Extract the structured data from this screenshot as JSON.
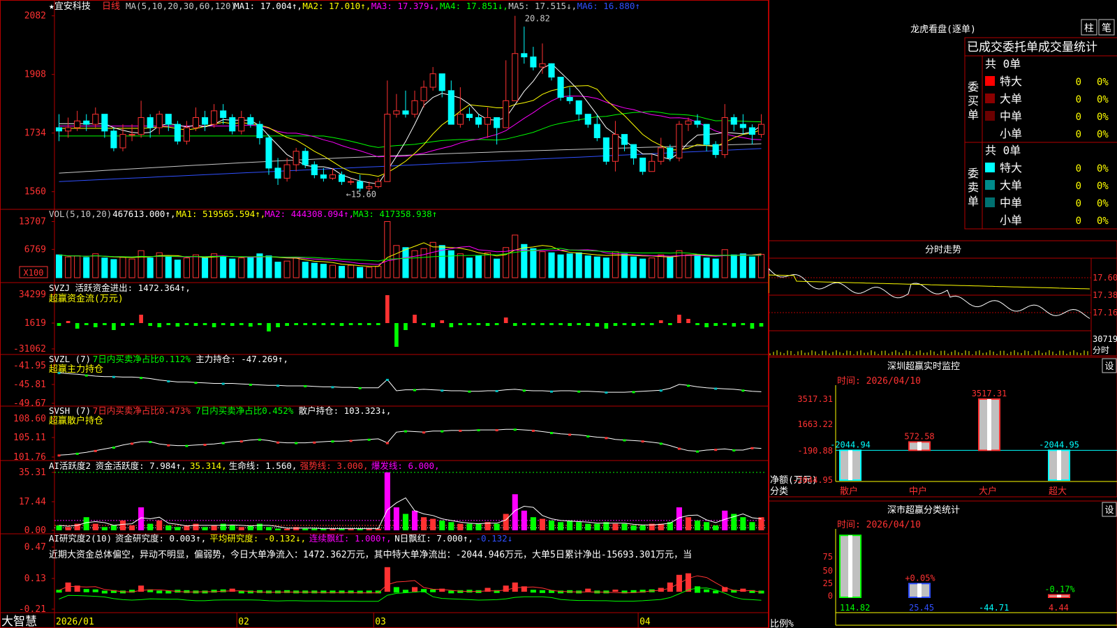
{
  "app": {
    "brand": "大智慧"
  },
  "stock": {
    "star": "★",
    "name": "宜安科技",
    "period": "日线"
  },
  "colors": {
    "up": "#ff3232",
    "down": "#00ffff",
    "ma1": "#ffffff",
    "ma2": "#ffff00",
    "ma3": "#ff00ff",
    "ma4": "#00ff00",
    "ma5": "#c8c8c8",
    "ma6": "#3050ff",
    "green": "#00ff00",
    "magenta": "#ff00ff",
    "yellow": "#ffff00"
  },
  "price_panel": {
    "header": [
      {
        "t": "MA(5,10,20,30,60,120)",
        "c": "#c8c8c8"
      },
      {
        "t": "MA1: 17.004↑,",
        "c": "#ffffff"
      },
      {
        "t": "MA2: 17.010↑,",
        "c": "#ffff00"
      },
      {
        "t": "MA3: 17.379↓,",
        "c": "#ff00ff"
      },
      {
        "t": "MA4: 17.851↓,",
        "c": "#00ff00"
      },
      {
        "t": "MA5: 17.515↓,",
        "c": "#c8c8c8"
      },
      {
        "t": "MA6: 16.880↑",
        "c": "#3050ff"
      }
    ],
    "yticks": [
      "2082",
      "1908",
      "1734",
      "1560"
    ],
    "high_label": "20.82",
    "low_label": "←15.60"
  },
  "vol_panel": {
    "header": [
      {
        "t": "VOL(5,10,20)",
        "c": "#c8c8c8"
      },
      {
        "t": "467613.000↑,",
        "c": "#ffffff"
      },
      {
        "t": "MA1: 519565.594↑,",
        "c": "#ffff00"
      },
      {
        "t": "MA2: 444308.094↑,",
        "c": "#ff00ff"
      },
      {
        "t": "MA3: 417358.938↑",
        "c": "#00ff00"
      }
    ],
    "yticks": [
      "13707",
      "6769"
    ],
    "unit": "X100"
  },
  "svzj_panel": {
    "header": [
      {
        "t": "SVZJ  活跃资金进出: 1472.364↑,",
        "c": "#ffffff"
      }
    ],
    "sub": "超赢资金流(万元)",
    "yticks": [
      "34299",
      "1619",
      "-31062"
    ]
  },
  "svzl_panel": {
    "header": [
      {
        "t": "SVZL (7)",
        "c": "#ffffff"
      },
      {
        "t": "7日内买卖净占比0.112%",
        "c": "#00ff00"
      },
      {
        "t": "主力持仓: -47.269↑,",
        "c": "#ffffff"
      }
    ],
    "sub": "超赢主力持仓",
    "yticks": [
      "-41.95",
      "-45.81",
      "-49.67"
    ]
  },
  "svsh_panel": {
    "header": [
      {
        "t": "SVSH (7)",
        "c": "#ffffff"
      },
      {
        "t": "7日内买卖净占比0.473%",
        "c": "#ff3232"
      },
      {
        "t": "7日内买卖净占比0.452%",
        "c": "#00ff00"
      },
      {
        "t": "散户持仓: 103.323↓,",
        "c": "#ffffff"
      }
    ],
    "sub": "超赢散户持仓",
    "yticks": [
      "108.60",
      "105.11",
      "101.76"
    ]
  },
  "ai_panel": {
    "header": [
      {
        "t": "AI活跃度2",
        "c": "#ffffff"
      },
      {
        "t": "资金活跃度: 7.984↑,",
        "c": "#ffffff"
      },
      {
        "t": "35.314,",
        "c": "#ffff00"
      },
      {
        "t": "生命线: 1.560,",
        "c": "#ffffff"
      },
      {
        "t": "强势线: 3.000,",
        "c": "#ff3232"
      },
      {
        "t": "爆发线: 6.000,",
        "c": "#ff00ff"
      }
    ],
    "yticks": [
      "35.31",
      "17.44",
      "0.00"
    ]
  },
  "ai2_panel": {
    "header": [
      {
        "t": "AI研究度2(10)",
        "c": "#ffffff"
      },
      {
        "t": "资金研究度: 0.003↑,",
        "c": "#ffffff"
      },
      {
        "t": "平均研究度: -0.132↓,",
        "c": "#ffff00"
      },
      {
        "t": "连续飘红: 1.000↑,",
        "c": "#ff00ff"
      },
      {
        "t": "N日飘红: 7.000↑,",
        "c": "#ffffff"
      },
      {
        "t": "-0.132↓",
        "c": "#3050ff"
      }
    ],
    "note": "近期大资金总体偏空，异动不明显，偏弱势，今日大单净流入：1472.362万元，其中特大单净流出：-2044.946万元，大单5日累计净出-15693.301万元，当",
    "yticks": [
      "0.47",
      "0.13",
      "-0.21"
    ]
  },
  "xaxis": {
    "labels": [
      "2026/01",
      "02",
      "03",
      "04"
    ]
  },
  "side": {
    "lhb_title": "龙虎看盘(逐单)",
    "btn_bar": "柱",
    "btn_pen": "笔",
    "stats_title": "已成交委托单成交量统计",
    "buy": {
      "side_label": "委买单",
      "total": "共 0单",
      "rows": [
        {
          "label": "特大",
          "val": "0",
          "pct": "0%",
          "color": "#ff0000"
        },
        {
          "label": "大单",
          "val": "0",
          "pct": "0%",
          "color": "#8b0000"
        },
        {
          "label": "中单",
          "val": "0",
          "pct": "0%",
          "color": "#6b0000"
        },
        {
          "label": "小单",
          "val": "0",
          "pct": "0%",
          "color": ""
        }
      ]
    },
    "sell": {
      "side_label": "委卖单",
      "total": "共 0单",
      "rows": [
        {
          "label": "特大",
          "val": "0",
          "pct": "0%",
          "color": "#00ffff"
        },
        {
          "label": "大单",
          "val": "0",
          "pct": "0%",
          "color": "#008b8b"
        },
        {
          "label": "中单",
          "val": "0",
          "pct": "0%",
          "color": "#007070"
        },
        {
          "label": "小单",
          "val": "0",
          "pct": "0%",
          "color": ""
        }
      ]
    },
    "intraday": {
      "title": "分时走势",
      "ylabels": [
        "17.60",
        "17.38",
        "17.16"
      ],
      "vol_label": "30719",
      "vol_unit": "分时"
    },
    "monitor": {
      "title": "深圳超赢实时监控",
      "settings": "设",
      "time": "时间: 2026/04/10",
      "yticks": [
        "3517.31",
        "1663.22",
        "-190.88",
        "-2044.95"
      ],
      "yaxis_title": "净额(万元)",
      "xaxis_title": "分类",
      "bars": [
        {
          "cat": "散户",
          "value": -2044.94,
          "label": "-2044.94"
        },
        {
          "cat": "中户",
          "value": 572.58,
          "label": "572.58"
        },
        {
          "cat": "大户",
          "value": 3517.31,
          "label": "3517.31"
        },
        {
          "cat": "超大",
          "value": -2044.95,
          "label": "-2044.95"
        }
      ]
    },
    "classify": {
      "title": "深市超赢分类统计",
      "settings": "设",
      "time": "时间: 2026/04/10",
      "yticks": [
        "75",
        "50",
        "25",
        "0"
      ],
      "yaxis_title": "比例%",
      "xaxis_title": "分类",
      "bars": [
        {
          "cat": "散户",
          "value": 114.82,
          "label": "114.82",
          "change": ""
        },
        {
          "cat": "中户",
          "value": 25.45,
          "label": "25.45",
          "change": "+0.05%"
        },
        {
          "cat": "大户",
          "value": -44.71,
          "label": "-44.71",
          "change": ""
        },
        {
          "cat": "超大",
          "value": 4.44,
          "label": "4.44",
          "change": "-0.17%"
        }
      ]
    }
  },
  "chart_data": {
    "type": "candlestick",
    "title": "宜安科技 日线",
    "ylim": [
      15.2,
      21.0
    ],
    "candles": [
      [
        17.5,
        17.4,
        17.9,
        17.1
      ],
      [
        17.4,
        17.5,
        17.8,
        17.2
      ],
      [
        17.5,
        17.7,
        18.0,
        17.4
      ],
      [
        17.7,
        17.6,
        17.9,
        17.4
      ],
      [
        17.6,
        17.9,
        18.1,
        17.5
      ],
      [
        17.9,
        17.4,
        17.9,
        17.2
      ],
      [
        17.4,
        16.9,
        17.5,
        16.8
      ],
      [
        16.9,
        17.3,
        17.6,
        16.8
      ],
      [
        17.3,
        17.3,
        17.6,
        17.1
      ],
      [
        17.3,
        17.8,
        18.3,
        17.2
      ],
      [
        17.8,
        17.5,
        17.9,
        17.2
      ],
      [
        17.5,
        17.9,
        18.0,
        17.3
      ],
      [
        17.9,
        17.6,
        17.9,
        17.4
      ],
      [
        17.6,
        17.1,
        17.7,
        17.0
      ],
      [
        17.1,
        17.5,
        17.7,
        17.0
      ],
      [
        17.5,
        17.8,
        18.1,
        17.4
      ],
      [
        17.8,
        17.6,
        18.0,
        17.4
      ],
      [
        17.6,
        18.0,
        18.2,
        17.5
      ],
      [
        18.0,
        17.8,
        18.2,
        17.6
      ],
      [
        17.8,
        17.4,
        17.9,
        17.3
      ],
      [
        17.4,
        17.8,
        18.0,
        17.3
      ],
      [
        17.8,
        17.6,
        17.9,
        17.5
      ],
      [
        17.6,
        17.2,
        17.7,
        17.0
      ],
      [
        17.2,
        16.3,
        17.3,
        16.1
      ],
      [
        16.3,
        16.0,
        16.6,
        15.8
      ],
      [
        16.0,
        16.4,
        16.6,
        15.9
      ],
      [
        16.4,
        16.8,
        16.9,
        16.2
      ],
      [
        16.8,
        16.4,
        16.9,
        16.3
      ],
      [
        16.4,
        16.1,
        16.5,
        16.0
      ],
      [
        16.1,
        16.0,
        16.3,
        15.9
      ],
      [
        16.0,
        16.1,
        16.3,
        15.95
      ],
      [
        16.1,
        15.9,
        16.2,
        15.8
      ],
      [
        15.9,
        15.9,
        16.0,
        15.8
      ],
      [
        15.9,
        15.7,
        16.1,
        15.6
      ],
      [
        15.7,
        15.75,
        15.9,
        15.6
      ],
      [
        15.75,
        15.9,
        16.0,
        15.7
      ],
      [
        15.9,
        17.9,
        18.9,
        15.9
      ],
      [
        17.9,
        18.0,
        18.5,
        17.8
      ],
      [
        18.0,
        17.9,
        18.6,
        17.8
      ],
      [
        17.9,
        18.3,
        18.6,
        17.8
      ],
      [
        18.3,
        18.7,
        18.9,
        18.1
      ],
      [
        18.7,
        19.1,
        19.3,
        18.6
      ],
      [
        19.1,
        18.6,
        19.1,
        18.4
      ],
      [
        18.6,
        17.6,
        18.9,
        17.6
      ],
      [
        17.6,
        17.9,
        18.7,
        17.5
      ],
      [
        17.9,
        17.8,
        18.1,
        17.7
      ],
      [
        17.8,
        17.6,
        17.9,
        17.5
      ],
      [
        17.6,
        17.8,
        18.1,
        17.2
      ],
      [
        17.8,
        17.5,
        17.8,
        17.0
      ],
      [
        17.5,
        18.3,
        19.5,
        17.5
      ],
      [
        18.3,
        19.7,
        20.82,
        18.3
      ],
      [
        19.7,
        19.6,
        20.5,
        19.4
      ],
      [
        19.6,
        19.3,
        19.9,
        19.2
      ],
      [
        19.3,
        19.4,
        20.0,
        19.1
      ],
      [
        19.4,
        19.0,
        19.4,
        18.9
      ],
      [
        19.0,
        18.4,
        19.0,
        18.3
      ],
      [
        18.4,
        18.3,
        18.7,
        18.2
      ],
      [
        18.3,
        17.9,
        18.3,
        17.7
      ],
      [
        17.9,
        17.6,
        17.9,
        17.5
      ],
      [
        17.6,
        17.2,
        17.9,
        17.1
      ],
      [
        17.2,
        16.5,
        17.2,
        16.4
      ],
      [
        16.5,
        17.3,
        17.7,
        16.2
      ],
      [
        17.3,
        17.0,
        17.3,
        16.8
      ],
      [
        17.0,
        16.6,
        17.0,
        16.4
      ],
      [
        16.6,
        16.2,
        16.6,
        16.1
      ],
      [
        16.2,
        16.5,
        16.7,
        16.2
      ],
      [
        16.5,
        16.9,
        17.2,
        16.4
      ],
      [
        16.9,
        16.6,
        17.0,
        16.5
      ],
      [
        16.6,
        17.6,
        17.7,
        16.5
      ],
      [
        17.6,
        17.7,
        17.8,
        17.4
      ],
      [
        17.7,
        17.6,
        17.9,
        17.5
      ],
      [
        17.6,
        17.0,
        17.6,
        16.8
      ],
      [
        17.0,
        16.7,
        17.1,
        16.6
      ],
      [
        16.7,
        17.8,
        18.2,
        16.6
      ],
      [
        17.8,
        17.6,
        17.9,
        17.4
      ],
      [
        17.6,
        17.5,
        17.9,
        17.3
      ],
      [
        17.5,
        17.3,
        17.6,
        17.0
      ],
      [
        17.3,
        17.6,
        17.9,
        17.2
      ]
    ],
    "volume": [
      44,
      40,
      42,
      39,
      46,
      38,
      35,
      39,
      36,
      52,
      38,
      48,
      40,
      34,
      38,
      44,
      38,
      46,
      40,
      36,
      38,
      40,
      46,
      42,
      30,
      32,
      38,
      30,
      28,
      26,
      24,
      22,
      24,
      20,
      20,
      22,
      108,
      62,
      58,
      52,
      56,
      68,
      62,
      52,
      46,
      38,
      42,
      48,
      36,
      58,
      82,
      64,
      56,
      50,
      48,
      44,
      46,
      48,
      42,
      40,
      38,
      50,
      46,
      40,
      36,
      38,
      44,
      40,
      52,
      44,
      42,
      38,
      36,
      54,
      44,
      46,
      40,
      45
    ],
    "svzj": [
      -4,
      1,
      -8,
      -3,
      -6,
      -2,
      -10,
      -4,
      -3,
      12,
      -4,
      -6,
      -3,
      -5,
      -2,
      -4,
      -3,
      -6,
      -2,
      -4,
      -2,
      -5,
      -3,
      -12,
      -6,
      -4,
      -3,
      -2,
      -2,
      -3,
      -2,
      -4,
      -2,
      -3,
      -2,
      -3,
      40,
      -34,
      -10,
      12,
      -3,
      -6,
      4,
      -6,
      -2,
      -3,
      -2,
      -4,
      -3,
      8,
      -4,
      -3,
      -2,
      -3,
      -2,
      -3,
      -4,
      -3,
      -4,
      -5,
      -8,
      -4,
      -3,
      -4,
      -2,
      -3,
      4,
      -3,
      12,
      6,
      -3,
      -6,
      -4,
      -2,
      -5,
      -3,
      -8,
      -5
    ],
    "svzl": [
      -43.4,
      -43.6,
      -43.7,
      -43.9,
      -44.1,
      -44.2,
      -44.2,
      -44.3,
      -44.3,
      -44.4,
      -44.6,
      -44.9,
      -45.1,
      -45.3,
      -45.3,
      -45.4,
      -45.5,
      -45.6,
      -45.6,
      -45.6,
      -45.7,
      -45.8,
      -45.9,
      -46.0,
      -46.0,
      -46.1,
      -46.1,
      -46.1,
      -46.2,
      -46.3,
      -46.3,
      -46.4,
      -46.4,
      -46.5,
      -46.5,
      -46.5,
      -44.8,
      -47.1,
      -46.9,
      -46.9,
      -46.8,
      -46.9,
      -47.0,
      -47.1,
      -47.1,
      -47.2,
      -47.2,
      -47.1,
      -47.1,
      -46.9,
      -46.8,
      -47.0,
      -47.1,
      -47.1,
      -47.2,
      -47.1,
      -47.1,
      -47.2,
      -47.2,
      -47.3,
      -47.4,
      -47.4,
      -47.4,
      -47.3,
      -47.2,
      -47.1,
      -47.0,
      -46.6,
      -45.8,
      -46.0,
      -46.3,
      -46.5,
      -46.6,
      -46.7,
      -46.8,
      -47.0,
      -47.2,
      -47.3
    ],
    "svsh": [
      102.1,
      102.2,
      102.4,
      102.6,
      102.9,
      103.2,
      103.5,
      103.9,
      104.2,
      104.5,
      104.5,
      104.1,
      103.9,
      103.8,
      103.8,
      103.9,
      104.0,
      104.1,
      104.3,
      104.5,
      104.6,
      104.8,
      104.9,
      104.7,
      104.4,
      104.3,
      104.3,
      104.3,
      104.4,
      104.5,
      104.6,
      104.6,
      104.7,
      104.8,
      104.9,
      105.0,
      104.3,
      106.2,
      106.4,
      106.3,
      106.2,
      106.4,
      106.4,
      106.5,
      106.5,
      106.5,
      106.6,
      106.6,
      106.6,
      106.7,
      106.7,
      106.6,
      106.5,
      106.3,
      106.1,
      105.9,
      105.8,
      105.7,
      105.5,
      105.3,
      105.2,
      104.9,
      104.8,
      104.7,
      104.6,
      104.4,
      104.2,
      103.8,
      103.3,
      102.9,
      102.8,
      103.0,
      103.1,
      103.2,
      103.0,
      103.0,
      103.4,
      103.3
    ],
    "ai_activity": [
      3,
      2,
      4,
      8,
      4,
      2,
      3,
      6,
      3,
      14,
      4,
      6,
      3,
      2,
      3,
      4,
      2,
      3,
      4,
      3,
      2,
      3,
      4,
      2,
      1,
      1,
      2,
      1,
      1,
      1,
      1,
      1,
      1,
      1,
      1,
      1,
      35.3,
      14,
      10,
      12,
      8,
      7,
      6,
      5,
      4,
      4,
      4,
      5,
      4,
      10,
      22,
      12,
      8,
      7,
      6,
      5,
      6,
      5,
      4,
      4,
      5,
      4,
      4,
      3,
      3,
      4,
      4,
      5,
      14,
      8,
      6,
      5,
      3,
      12,
      10,
      8,
      5,
      7.98
    ],
    "ai_research": [
      0.05,
      0.12,
      0.08,
      0.07,
      0.06,
      0.02,
      0.04,
      0.03,
      0.05,
      0.08,
      0.06,
      0.03,
      0.02,
      0.05,
      0.04,
      0.03,
      0.03,
      0.05,
      0.06,
      0.04,
      0.03,
      0.03,
      0.04,
      0.03,
      0.03,
      0.04,
      0.03,
      0.03,
      0.03,
      0.03,
      0.03,
      0.03,
      0.03,
      0.02,
      0.03,
      0.03,
      0.32,
      0.12,
      0.05,
      0.06,
      0.07,
      0.06,
      0.04,
      0.03,
      0.04,
      0.05,
      0.04,
      0.05,
      0.04,
      0.08,
      0.12,
      0.07,
      0.05,
      0.04,
      0.04,
      0.03,
      0.04,
      0.03,
      0.04,
      0.03,
      0.03,
      0.02,
      0.03,
      0.04,
      0.05,
      0.06,
      0.05,
      0.12,
      0.22,
      0.24,
      0.14,
      0.06,
      0.03,
      0.06,
      0.05,
      0.04,
      0.04,
      0.003
    ],
    "ai_research_sign": [
      -1,
      1,
      1,
      -1,
      -1,
      -1,
      -1,
      -1,
      -1,
      1,
      -1,
      -1,
      -1,
      -1,
      -1,
      -1,
      -1,
      -1,
      -1,
      1,
      -1,
      -1,
      -1,
      -1,
      -1,
      -1,
      -1,
      -1,
      -1,
      -1,
      -1,
      -1,
      -1,
      -1,
      -1,
      -1,
      1,
      -1,
      -1,
      1,
      -1,
      -1,
      1,
      -1,
      -1,
      -1,
      -1,
      1,
      -1,
      1,
      1,
      1,
      -1,
      -1,
      -1,
      -1,
      -1,
      -1,
      1,
      -1,
      -1,
      1,
      -1,
      -1,
      -1,
      -1,
      1,
      1,
      1,
      1,
      -1,
      -1,
      -1,
      1,
      -1,
      1,
      -1,
      -1
    ]
  }
}
